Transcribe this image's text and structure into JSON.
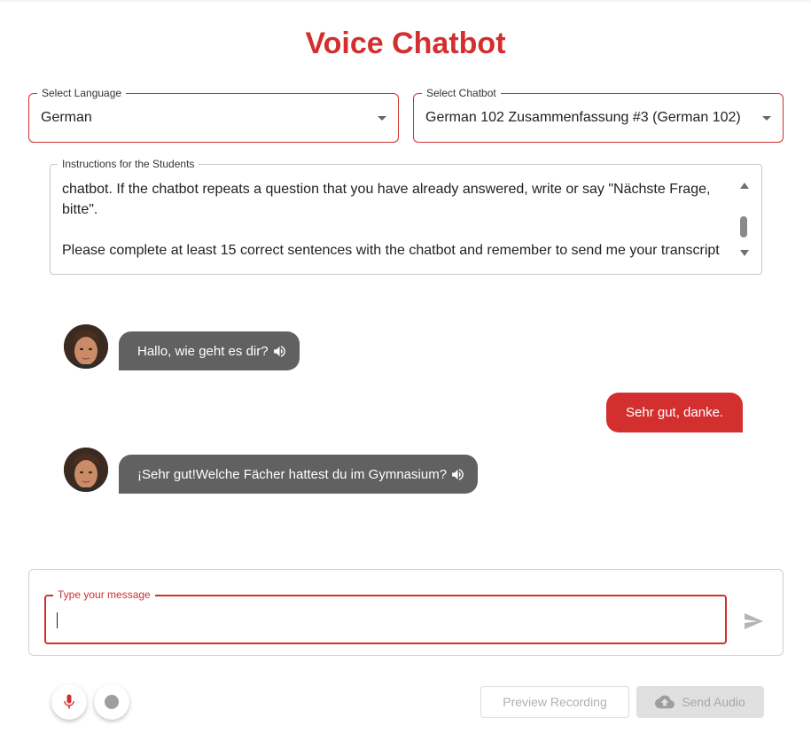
{
  "app": {
    "title": "Voice Chatbot"
  },
  "language_select": {
    "label": "Select Language",
    "value": "German"
  },
  "chatbot_select": {
    "label": "Select Chatbot",
    "value": "German 102 Zusammenfassung #3 (German 102)"
  },
  "instructions": {
    "label": "Instructions for the Students",
    "text": "chatbot. If the chatbot repeats a question that you have already answered, write or say \"Nächste Frage, bitte\".\n\nPlease complete at least 15 correct sentences with the chatbot and remember to send me your transcript"
  },
  "messages": [
    {
      "role": "bot",
      "text": "Hallo, wie geht es dir?"
    },
    {
      "role": "user",
      "text": "Sehr gut, danke."
    },
    {
      "role": "bot",
      "text": "¡Sehr gut!Welche Fächer hattest du im Gymnasium?"
    }
  ],
  "composer": {
    "label": "Type your message",
    "value": ""
  },
  "recording": {
    "preview_label": "Preview Recording",
    "send_audio_label": "Send Audio"
  },
  "icons": {
    "speaker": "volume-icon",
    "send": "send-icon",
    "mic": "mic-icon",
    "record": "record-icon",
    "upload": "cloud-upload-icon",
    "caret": "dropdown-arrow-icon"
  },
  "colors": {
    "accent": "#d32f2f",
    "bot_bubble": "#616161",
    "disabled": "#e0e0e0"
  }
}
